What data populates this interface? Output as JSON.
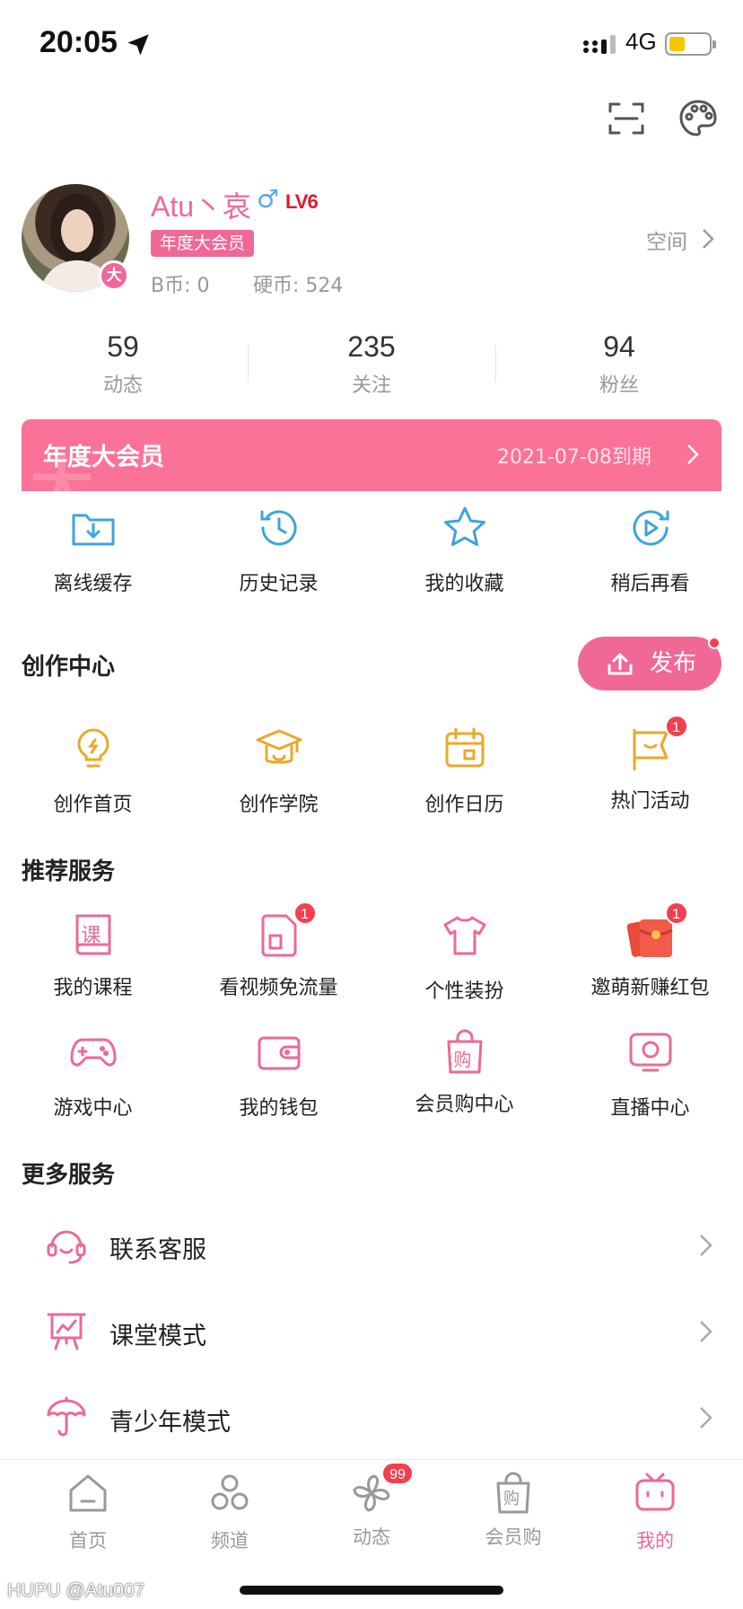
{
  "status_bar": {
    "time": "20:05",
    "network": "4G"
  },
  "profile": {
    "name": "Atu丶哀",
    "gender_symbol": "♂",
    "level": "LV6",
    "vip_tag": "年度大会员",
    "b_coin": "B币: 0",
    "hard_coin": "硬币: 524",
    "space_link": "空间",
    "avatar_badge": "大"
  },
  "stats": [
    {
      "value": "59",
      "label": "动态"
    },
    {
      "value": "235",
      "label": "关注"
    },
    {
      "value": "94",
      "label": "粉丝"
    }
  ],
  "vip_banner": {
    "title": "年度大会员",
    "expire": "2021-07-08到期",
    "watermark": "大"
  },
  "quick": [
    {
      "label": "离线缓存",
      "icon": "download-folder-icon"
    },
    {
      "label": "历史记录",
      "icon": "history-clock-icon"
    },
    {
      "label": "我的收藏",
      "icon": "star-icon"
    },
    {
      "label": "稍后再看",
      "icon": "play-later-icon"
    }
  ],
  "creation": {
    "title": "创作中心",
    "publish": "发布",
    "items": [
      {
        "label": "创作首页",
        "icon": "lightbulb-icon"
      },
      {
        "label": "创作学院",
        "icon": "graduation-cap-icon"
      },
      {
        "label": "创作日历",
        "icon": "calendar-icon"
      },
      {
        "label": "热门活动",
        "icon": "flag-icon",
        "badge": "1"
      }
    ]
  },
  "recommend": {
    "title": "推荐服务",
    "items": [
      {
        "label": "我的课程",
        "icon": "course-book-icon",
        "glyph": "课"
      },
      {
        "label": "看视频免流量",
        "icon": "sim-card-icon",
        "badge": "1"
      },
      {
        "label": "个性装扮",
        "icon": "tshirt-icon"
      },
      {
        "label": "邀萌新赚红包",
        "icon": "red-envelope-icon",
        "badge": "1"
      },
      {
        "label": "游戏中心",
        "icon": "gamepad-icon"
      },
      {
        "label": "我的钱包",
        "icon": "wallet-icon"
      },
      {
        "label": "会员购中心",
        "icon": "shopping-bag-icon",
        "glyph": "购"
      },
      {
        "label": "直播中心",
        "icon": "live-tv-icon"
      }
    ]
  },
  "more": {
    "title": "更多服务",
    "items": [
      {
        "label": "联系客服",
        "icon": "headset-icon"
      },
      {
        "label": "课堂模式",
        "icon": "classroom-board-icon"
      },
      {
        "label": "青少年模式",
        "icon": "umbrella-icon"
      }
    ]
  },
  "tabs": [
    {
      "label": "首页",
      "icon": "home-icon"
    },
    {
      "label": "频道",
      "icon": "channel-icon"
    },
    {
      "label": "动态",
      "icon": "pinwheel-icon",
      "badge": "99"
    },
    {
      "label": "会员购",
      "icon": "shopping-bag-icon",
      "glyph": "购"
    },
    {
      "label": "我的",
      "icon": "tv-icon",
      "active": true
    }
  ],
  "watermark": "HUPU @Atu007",
  "colors": {
    "pink": "#fb7299",
    "accent": "#f06896",
    "blue": "#3fa3dc",
    "yellow": "#e8a92a",
    "badge": "#f43f4e"
  }
}
